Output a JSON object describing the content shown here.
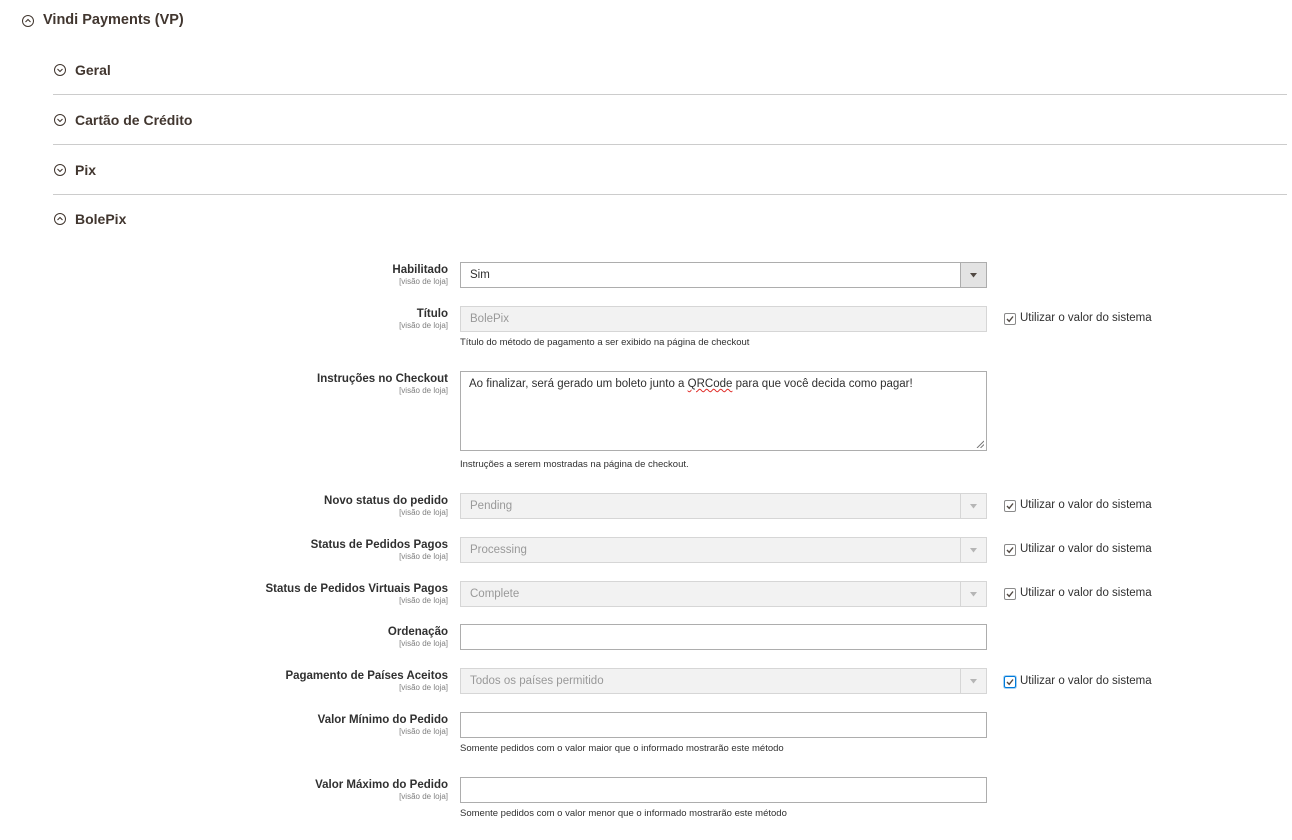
{
  "section": {
    "title": "Vindi Payments (VP)",
    "groups": [
      {
        "title": "Geral",
        "expanded": false
      },
      {
        "title": "Cartão de Crédito",
        "expanded": false
      },
      {
        "title": "Pix",
        "expanded": false
      },
      {
        "title": "BolePix",
        "expanded": true
      }
    ]
  },
  "scope_label": "[visão de loja]",
  "use_system_label": "Utilizar o valor do sistema",
  "fields": {
    "habilitado": {
      "label": "Habilitado",
      "value": "Sim"
    },
    "titulo": {
      "label": "Título",
      "value": "BolePix",
      "note": "Título do método de pagamento a ser exibido na página de checkout",
      "use_system": true
    },
    "instrucoes": {
      "label": "Instruções no Checkout",
      "value_before": "Ao finalizar, será gerado um boleto junto a ",
      "value_misspelled": "QRCode",
      "value_after": " para que você decida como pagar!",
      "note": "Instruções a serem mostradas na página de checkout."
    },
    "novo_status": {
      "label": "Novo status do pedido",
      "value": "Pending",
      "use_system": true
    },
    "status_pagos": {
      "label": "Status de Pedidos Pagos",
      "value": "Processing",
      "use_system": true
    },
    "status_virtuais": {
      "label": "Status de Pedidos Virtuais Pagos",
      "value": "Complete",
      "use_system": true
    },
    "ordenacao": {
      "label": "Ordenação",
      "value": ""
    },
    "paises": {
      "label": "Pagamento de Países Aceitos",
      "value": "Todos os países permitido",
      "use_system": true
    },
    "valor_minimo": {
      "label": "Valor Mínimo do Pedido",
      "value": "",
      "note": "Somente pedidos com o valor maior que o informado mostrarão este método"
    },
    "valor_maximo": {
      "label": "Valor Máximo do Pedido",
      "value": "",
      "note": "Somente pedidos com o valor menor que o informado mostrarão este método"
    }
  }
}
